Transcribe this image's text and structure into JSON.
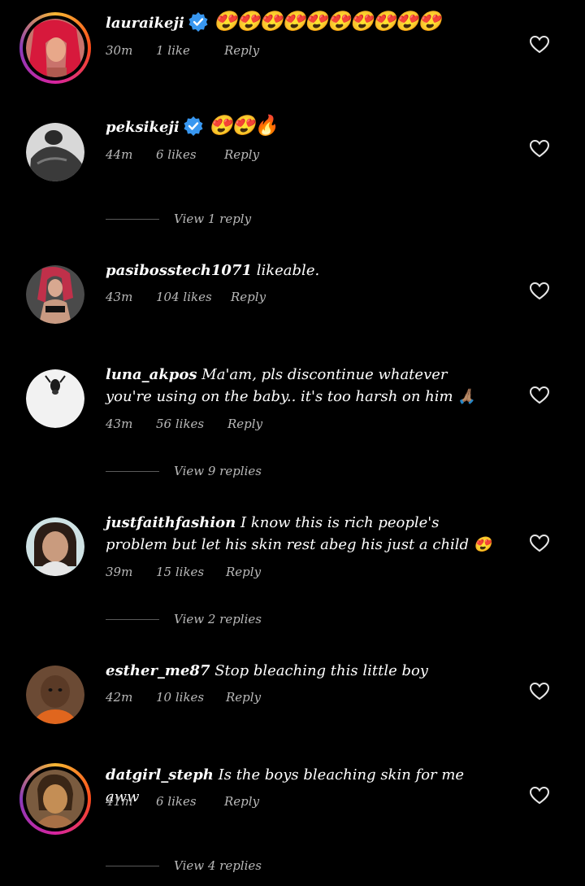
{
  "colors": {
    "background": "#000000",
    "text": "#ffffff",
    "meta": "#b9b9b9",
    "verified_badge": "#3897f0",
    "story_ring_start": "#f7b733",
    "story_ring_end": "#8a3ab9"
  },
  "comments": [
    {
      "username": "lauraikeji",
      "verified": true,
      "text": "😍😍😍😍😍😍😍😍😍😍",
      "time": "30m",
      "likes": "1 like",
      "reply_label": "Reply",
      "view_replies": null
    },
    {
      "username": "peksikeji",
      "verified": true,
      "text": "😍😍🔥",
      "time": "44m",
      "likes": "6 likes",
      "reply_label": "Reply",
      "view_replies": "View 1 reply"
    },
    {
      "username": "pasibosstech1071",
      "verified": false,
      "text": "likeable.",
      "time": "43m",
      "likes": "104 likes",
      "reply_label": "Reply",
      "view_replies": null
    },
    {
      "username": "luna_akpos",
      "verified": false,
      "text": "Ma'am, pls discontinue whatever you're using on the baby.. it's too harsh on him 🙏🏽",
      "time": "43m",
      "likes": "56 likes",
      "reply_label": "Reply",
      "view_replies": "View 9 replies"
    },
    {
      "username": "justfaithfashion",
      "verified": false,
      "text": "I know this is rich people's problem but let his skin rest abeg his just a child 😍",
      "time": "39m",
      "likes": "15 likes",
      "reply_label": "Reply",
      "view_replies": "View 2 replies"
    },
    {
      "username": "esther_me87",
      "verified": false,
      "text": "Stop bleaching this little boy",
      "time": "42m",
      "likes": "10 likes",
      "reply_label": "Reply",
      "view_replies": null
    },
    {
      "username": "datgirl_steph",
      "verified": false,
      "text": "Is the boys bleaching skin for me aww",
      "time": "41m",
      "likes": "6 likes",
      "reply_label": "Reply",
      "view_replies": "View 4 replies"
    }
  ]
}
